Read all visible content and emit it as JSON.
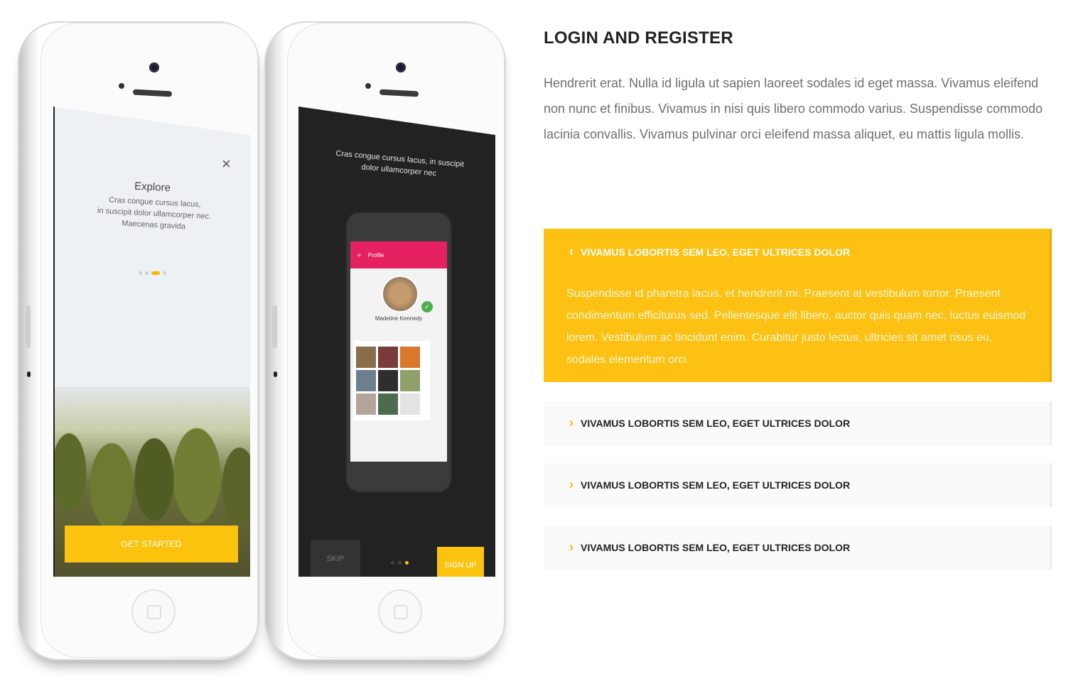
{
  "phone_left": {
    "close_glyph": "×",
    "title": "Explore",
    "text_lines": [
      "Cras congue cursus lacus,",
      "in suscipit dolor ullamcorper nec.",
      "Maecenas gravida"
    ],
    "cta_label": "GET STARTED"
  },
  "phone_right": {
    "text_lines": [
      "Cras congue cursus lacus, in suscipit",
      "dolor ullamcorper nec"
    ],
    "app_bar_title": "Profile",
    "profile_name": "Madeline Kennedy",
    "skip_label": "SKIP",
    "signup_label": "SIGN UP"
  },
  "section": {
    "heading": "LOGIN AND REGISTER",
    "intro": "Hendrerit erat. Nulla id ligula ut sapien laoreet sodales id eget massa. Vivamus eleifend non nunc et finibus. Vivamus in nisi quis libero commodo varius. Suspendisse commodo lacinia convallis. Vivamus pulvinar orci eleifend massa aliquet, eu mattis ligula mollis."
  },
  "accordion": {
    "items": [
      {
        "title": "VIVAMUS LOBORTIS SEM LEO, EGET ULTRICES DOLOR",
        "expanded": true,
        "body": "Suspendisse id pharetra lacus, et hendrerit mi. Praesent at vestibulum tortor. Praesent condimentum efficiturus sed. Pellentesque elit libero, auctor quis quam nec, luctus euismod lorem. Vestibulum ac tincidunt enim. Curabitur justo lectus, ultricies sit amet risus eu, sodales elementum orci."
      },
      {
        "title": "VIVAMUS LOBORTIS SEM LEO, EGET ULTRICES DOLOR",
        "expanded": false
      },
      {
        "title": "VIVAMUS LOBORTIS SEM LEO, EGET ULTRICES DOLOR",
        "expanded": false
      },
      {
        "title": "VIVAMUS LOBORTIS SEM LEO, EGET ULTRICES DOLOR",
        "expanded": false
      }
    ],
    "icon_expanded": "chevron-left-icon",
    "icon_collapsed": "chevron-right-icon"
  },
  "colors": {
    "accent": "#fcc112",
    "heading": "#222222",
    "body_text": "#6f6f6f",
    "dark_screen": "#222222",
    "android_bar": "#e6215f"
  }
}
